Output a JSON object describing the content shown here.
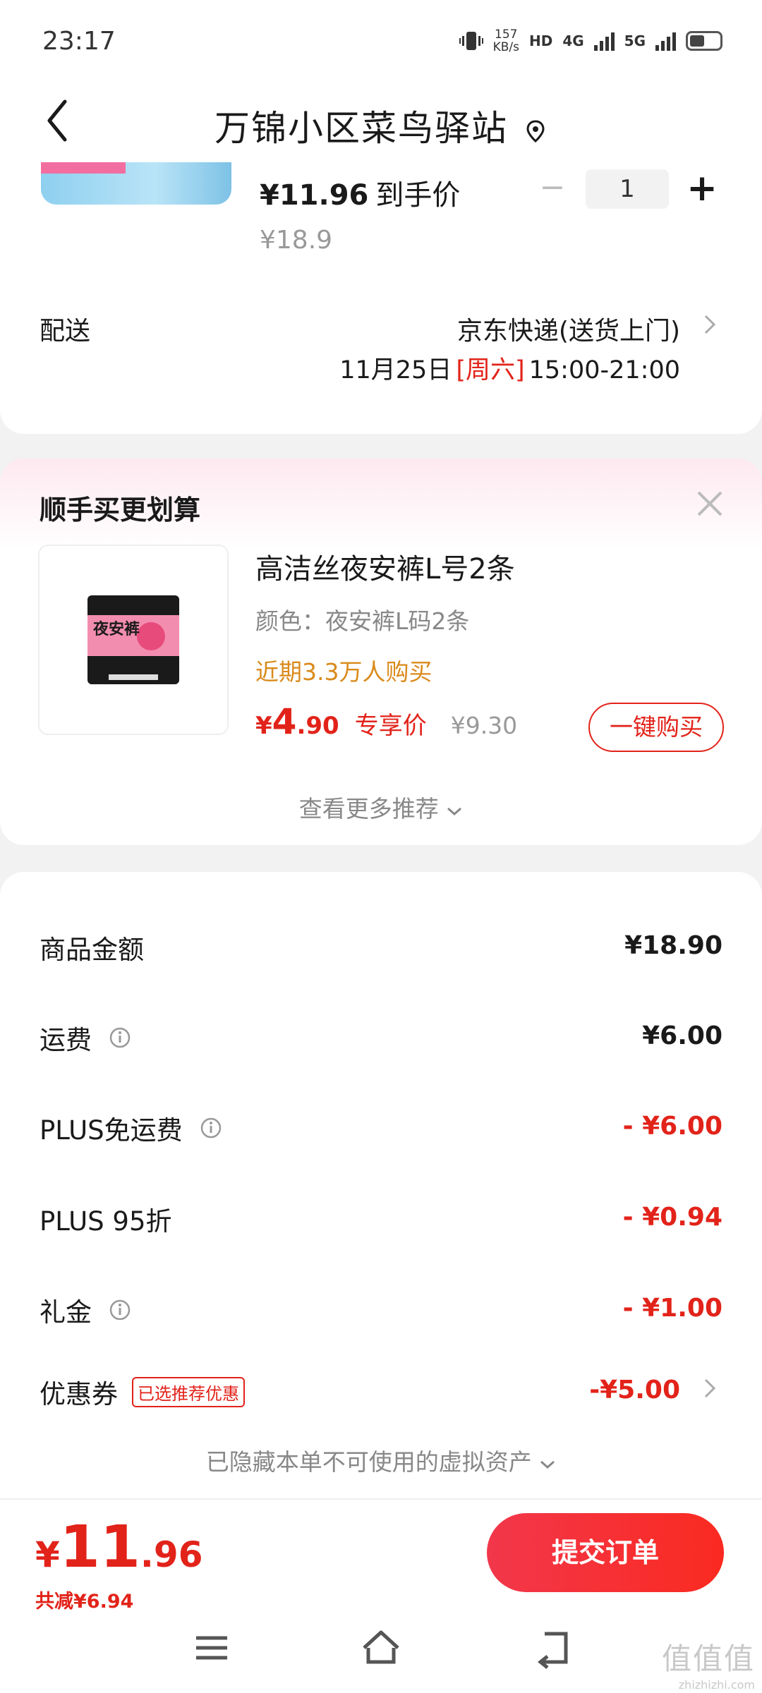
{
  "status_bar": {
    "time": "23:17",
    "speed_value": "157",
    "speed_unit": "KB/s",
    "hd": "HD",
    "net1": "4G",
    "net2": "5G"
  },
  "header": {
    "title": "万锦小区菜鸟驿站"
  },
  "item": {
    "price": "¥11.96",
    "price_label": "到手价",
    "original_price": "¥18.9",
    "quantity": "1",
    "minus": "−",
    "plus": "+"
  },
  "shipping": {
    "label": "配送",
    "carrier": "京东快递(送货上门)",
    "date": "11月25日",
    "weekday": "[周六]",
    "window": "15:00-21:00"
  },
  "recommend": {
    "title": "顺手买更划算",
    "name": "高洁丝夜安裤L号2条",
    "spec": "颜色：夜安裤L码2条",
    "sold": "近期3.3万人购买",
    "price_currency": "¥",
    "price_int": "4",
    "price_dec": ".90",
    "price_tag": "专享价",
    "original_price": "¥9.30",
    "buy_button": "一键购买",
    "more": "查看更多推荐",
    "package_text": "夜安裤"
  },
  "summary": {
    "rows": [
      {
        "name": "商品金额",
        "value": "¥18.90"
      },
      {
        "name": "运费",
        "value": "¥6.00"
      },
      {
        "name": "PLUS免运费",
        "value": "- ¥6.00"
      },
      {
        "name": "PLUS 95折",
        "value": "- ¥0.94"
      },
      {
        "name": "礼金",
        "value": "- ¥1.00"
      },
      {
        "name": "优惠券",
        "value": "-¥5.00"
      }
    ],
    "coupon_tag": "已选推荐优惠",
    "hidden_assets": "已隐藏本单不可使用的虚拟资产"
  },
  "footer": {
    "total_currency": "¥",
    "total_int": "11",
    "total_dec": ".96",
    "saved": "共减¥6.94",
    "submit": "提交订单"
  },
  "watermark": {
    "big": "值值值",
    "small": "zhizhizhi.com"
  },
  "colors": {
    "accent_red": "#e2231a",
    "sold_orange": "#d98a1b"
  }
}
